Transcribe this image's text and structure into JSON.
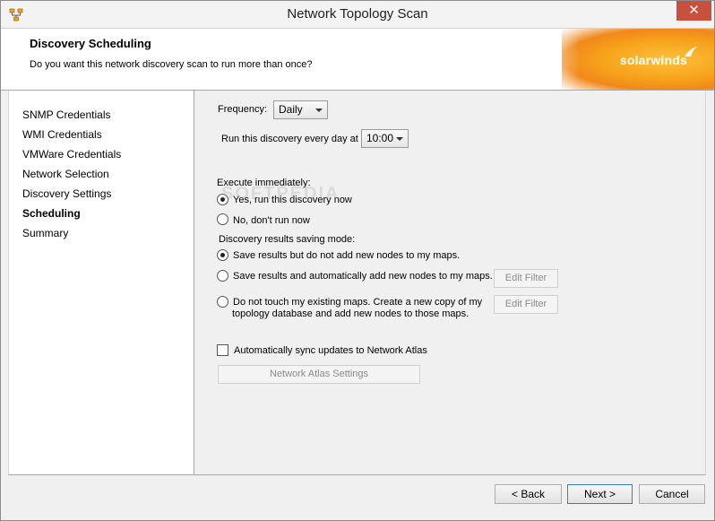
{
  "window": {
    "title": "Network Topology Scan",
    "close_glyph": "✕"
  },
  "header": {
    "title": "Discovery Scheduling",
    "subtitle": "Do you want this network discovery scan to run more than once?",
    "brand": "solarwinds"
  },
  "nav": {
    "items": [
      {
        "label": "SNMP Credentials"
      },
      {
        "label": "WMI Credentials"
      },
      {
        "label": "VMWare Credentials"
      },
      {
        "label": "Network Selection"
      },
      {
        "label": "Discovery Settings"
      },
      {
        "label": "Scheduling"
      },
      {
        "label": "Summary"
      }
    ],
    "active": "Scheduling"
  },
  "form": {
    "frequency_label": "Frequency:",
    "frequency_value": "Daily",
    "run_label": "Run this discovery every day at",
    "time_value": "10:00",
    "execute_label": "Execute immediately:",
    "execute_options": [
      {
        "label": "Yes, run this discovery now",
        "checked": true
      },
      {
        "label": "No, don't run now",
        "checked": false
      }
    ],
    "saving_label": "Discovery results saving mode:",
    "saving_options": [
      {
        "label": "Save results but do not add new nodes to my maps.",
        "checked": true
      },
      {
        "label": "Save results and automatically add new nodes to my maps.",
        "checked": false
      },
      {
        "label_line1": "Do not touch my existing maps. Create a new copy of my",
        "label_line2": "topology database and add new nodes to those maps.",
        "checked": false
      }
    ],
    "edit_filter_label": "Edit Filter",
    "sync_label": "Automatically sync updates to Network Atlas",
    "sync_checked": false,
    "atlas_settings_label": "Network Atlas Settings"
  },
  "footer": {
    "back_label": "< Back",
    "next_label": "Next >",
    "cancel_label": "Cancel"
  },
  "watermark": "SOFTPEDIA",
  "colors": {
    "close": "#c7503f",
    "brand_orange": "#f7a21b",
    "default_button_border": "#3c7fb1"
  }
}
